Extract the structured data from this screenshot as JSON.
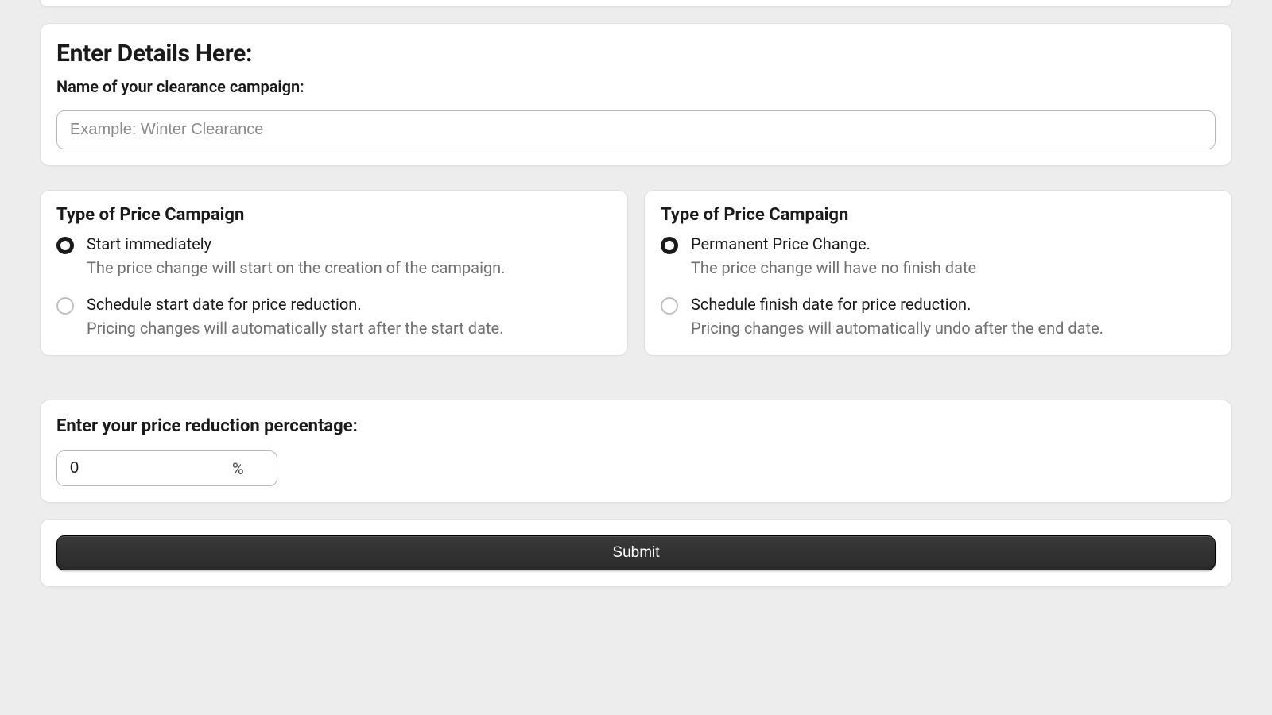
{
  "details": {
    "heading": "Enter Details Here:",
    "name_label": "Name of your clearance campaign:",
    "name_placeholder": "Example: Winter Clearance",
    "name_value": ""
  },
  "start_group": {
    "title": "Type of Price Campaign",
    "option_immediate": {
      "label": "Start immediately",
      "desc": "The price change will start on the creation of the campaign."
    },
    "option_schedule_start": {
      "label": "Schedule start date for price reduction.",
      "desc": "Pricing changes will automatically start after the start date."
    }
  },
  "end_group": {
    "title": "Type of Price Campaign",
    "option_permanent": {
      "label": "Permanent Price Change.",
      "desc": "The price change will have no finish date"
    },
    "option_schedule_finish": {
      "label": "Schedule finish date for price reduction.",
      "desc": "Pricing changes will automatically undo after the end date."
    }
  },
  "percentage": {
    "label": "Enter your price reduction percentage:",
    "value": "0",
    "suffix": "%"
  },
  "submit_label": "Submit"
}
